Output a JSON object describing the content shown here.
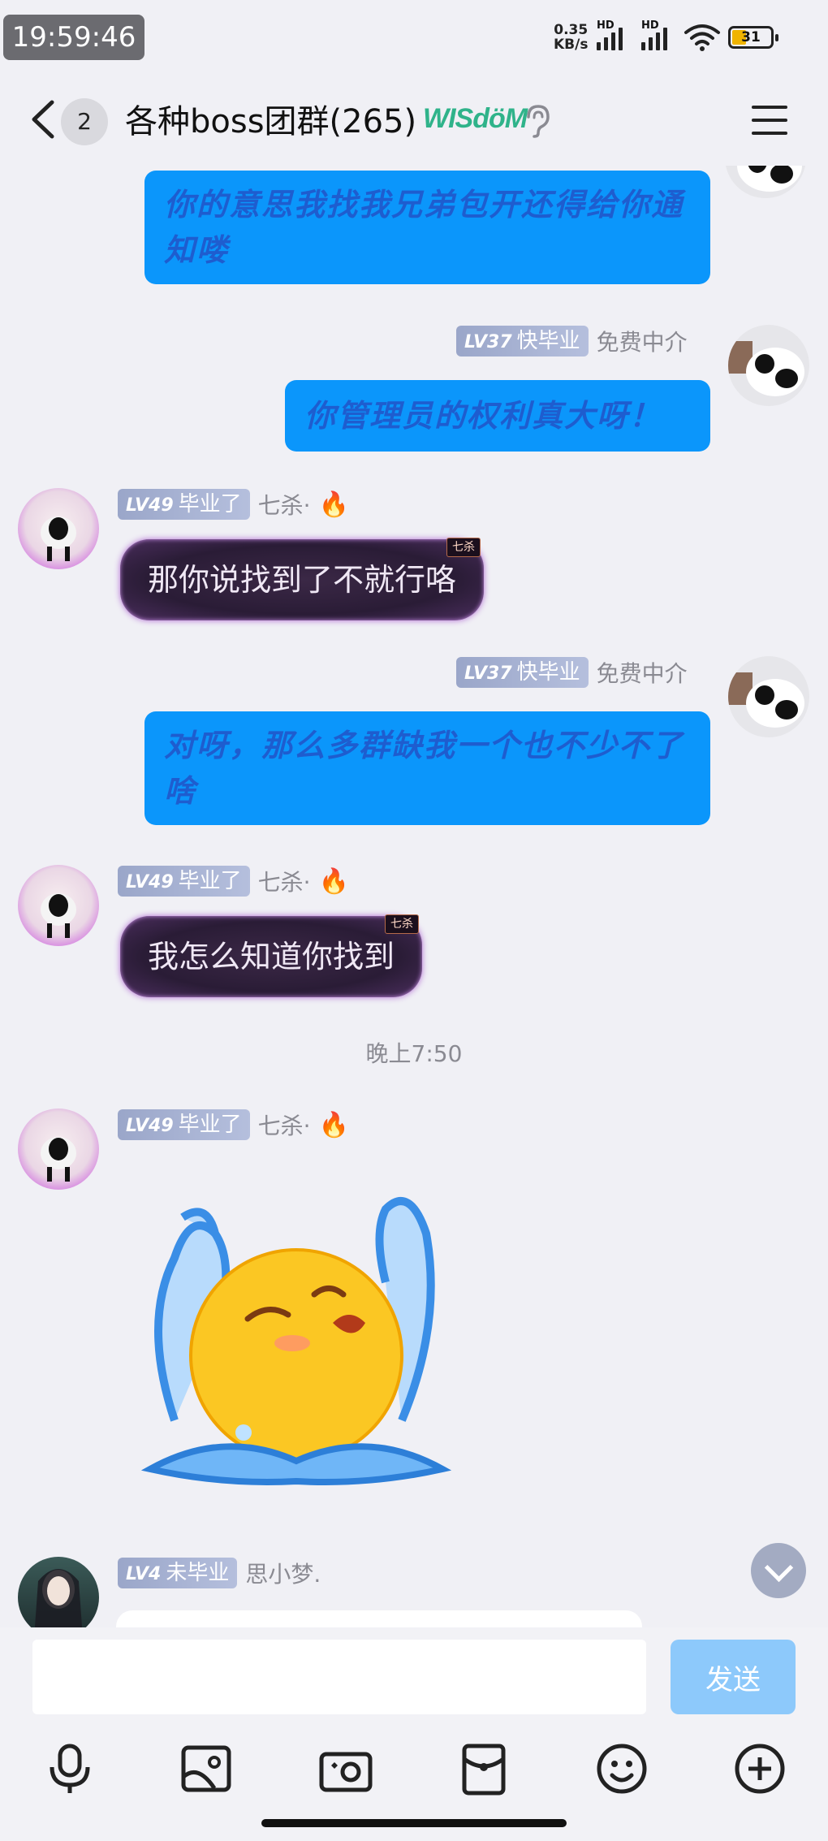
{
  "status": {
    "time": "19:59:46",
    "net_speed_value": "0.35",
    "net_speed_unit": "KB/s",
    "hd_label": "HD",
    "battery": "31"
  },
  "header": {
    "unread_count": "2",
    "title": "各种boss团群(265)",
    "wisdom_label": "WISdöM"
  },
  "messages": {
    "m1": {
      "text": "你的意思我找我兄弟包开还得给你通知喽"
    },
    "m2": {
      "level": "LV37",
      "title": "快毕业",
      "name": "免费中介",
      "text": "你管理员的权利真大呀！"
    },
    "m3": {
      "level": "LV49",
      "title": "毕业了",
      "name": "七杀·",
      "tag": "七杀",
      "text": "那你说找到了不就行咯"
    },
    "m4": {
      "level": "LV37",
      "title": "快毕业",
      "name": "免费中介",
      "text": "对呀，那么多群缺我一个也不少不了啥"
    },
    "m5": {
      "level": "LV49",
      "title": "毕业了",
      "name": "七杀·",
      "tag": "七杀",
      "text": "我怎么知道你找到"
    },
    "divider": "晚上7:50",
    "m6": {
      "level": "LV49",
      "title": "毕业了",
      "name": "七杀·"
    },
    "m7": {
      "level": "LV4",
      "title": "未毕业",
      "name": "思小梦."
    }
  },
  "composer": {
    "input_value": "",
    "send_label": "发送"
  },
  "colors": {
    "bubble_blue": "#0b96fb",
    "send_disabled": "#8dc9fb",
    "badge": "#9aa6c9"
  },
  "icons": [
    "back-arrow-icon",
    "ear-icon",
    "menu-icon",
    "fire-icon",
    "microphone-icon",
    "image-icon",
    "camera-icon",
    "red-packet-icon",
    "emoji-icon",
    "plus-icon",
    "chevron-down-icon"
  ]
}
